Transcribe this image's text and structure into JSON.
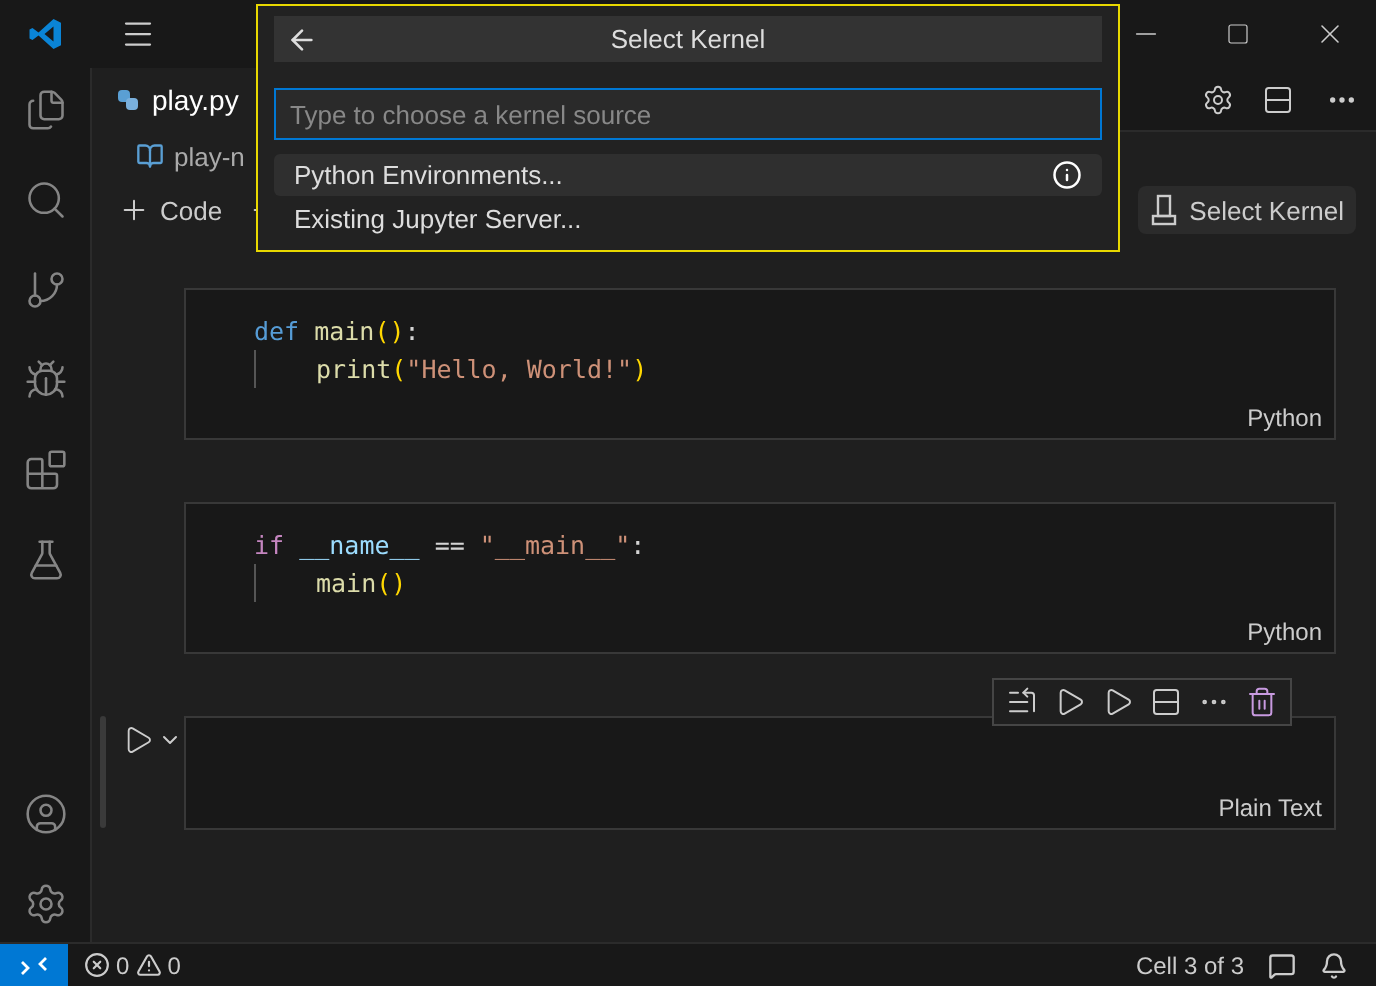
{
  "tabs": [
    {
      "label": "play.py",
      "selected": true
    }
  ],
  "breadcrumb": "play-n",
  "notebook_toolbar": {
    "add_code_label": "Code"
  },
  "kernel_button": "Select Kernel",
  "cells": [
    {
      "kind": "code",
      "language": "Python",
      "focused": false,
      "lines": [
        [
          {
            "t": "def",
            "color": "#569cd6"
          },
          {
            "t": " main",
            "color": "#dcdcaa"
          },
          {
            "t": "()",
            "color": "#ffd700"
          },
          {
            "t": ":",
            "color": "#d4d4d4"
          }
        ],
        [
          {
            "t": "print",
            "color": "#dcdcaa"
          },
          {
            "t": "(",
            "color": "#ffd700"
          },
          {
            "t": "\"Hello, World!\"",
            "color": "#ce9178"
          },
          {
            "t": ")",
            "color": "#ffd700"
          }
        ]
      ]
    },
    {
      "kind": "code",
      "language": "Python",
      "focused": false,
      "lines": [
        [
          {
            "t": "if",
            "color": "#c586c0"
          },
          {
            "t": " __name__",
            "color": "#9cdcfe"
          },
          {
            "t": " == ",
            "color": "#d4d4d4"
          },
          {
            "t": "\"__main__\"",
            "color": "#ce9178"
          },
          {
            "t": ":",
            "color": "#d4d4d4"
          }
        ],
        [
          {
            "t": "main",
            "color": "#dcdcaa"
          },
          {
            "t": "()",
            "color": "#ffd700"
          }
        ]
      ]
    },
    {
      "kind": "text",
      "language": "Plain Text",
      "focused": true
    }
  ],
  "quick_pick": {
    "title": "Select Kernel",
    "placeholder": "Type to choose a kernel source",
    "items": [
      {
        "label": "Python Environments...",
        "selected": true
      },
      {
        "label": "Existing Jupyter Server...",
        "selected": false
      }
    ]
  },
  "status_bar": {
    "errors": "0",
    "warnings": "0",
    "cell_position": "Cell 3 of 3"
  }
}
